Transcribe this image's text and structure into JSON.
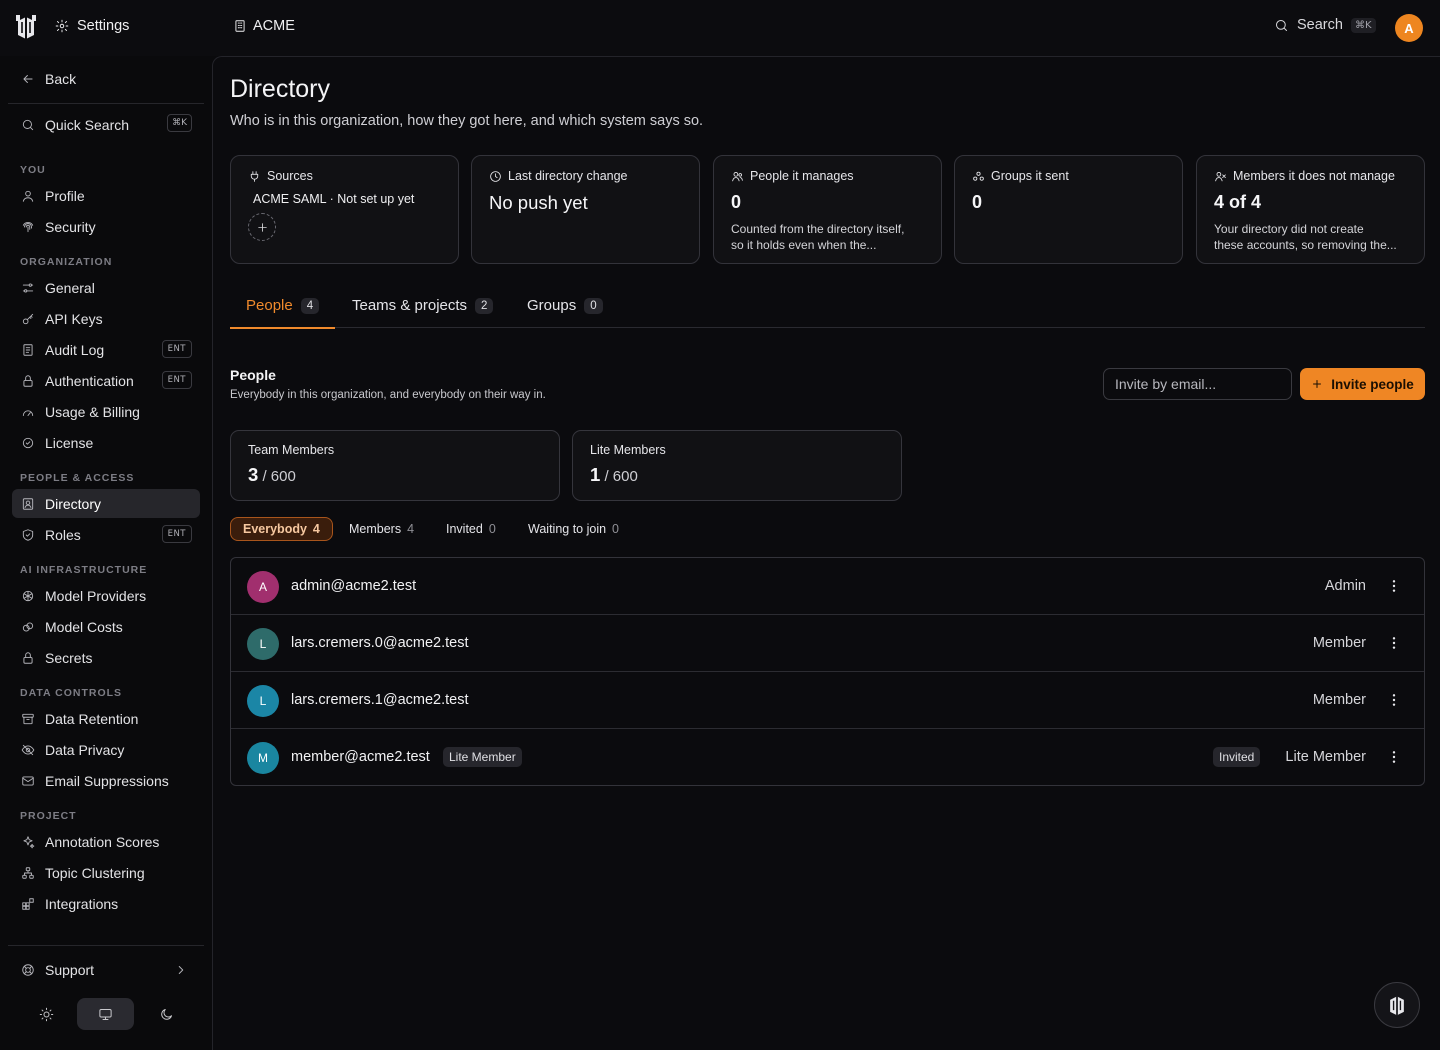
{
  "topbar": {
    "settings_label": "Settings",
    "org_label": "ACME",
    "search_label": "Search",
    "search_shortcut": "⌘K",
    "avatar_initial": "A",
    "avatar_color": "#ee8620"
  },
  "sidebar": {
    "back_label": "Back",
    "quick_search_label": "Quick Search",
    "quick_search_shortcut": "⌘K",
    "sections": {
      "you": "YOU",
      "organization": "ORGANIZATION",
      "people_access": "PEOPLE & ACCESS",
      "ai_infrastructure": "AI INFRASTRUCTURE",
      "data_controls": "DATA CONTROLS",
      "project": "PROJECT"
    },
    "items": {
      "profile": "Profile",
      "security": "Security",
      "general": "General",
      "api_keys": "API Keys",
      "audit_log": "Audit Log",
      "authentication": "Authentication",
      "usage_billing": "Usage & Billing",
      "license": "License",
      "directory": "Directory",
      "roles": "Roles",
      "model_providers": "Model Providers",
      "model_costs": "Model Costs",
      "secrets": "Secrets",
      "data_retention": "Data Retention",
      "data_privacy": "Data Privacy",
      "email_suppressions": "Email Suppressions",
      "annotation_scores": "Annotation Scores",
      "topic_clustering": "Topic Clustering",
      "integrations": "Integrations"
    },
    "ent_badge": "ENT",
    "support_label": "Support",
    "active_item": "Directory",
    "active_theme": "system"
  },
  "page": {
    "title": "Directory",
    "subtitle": "Who is in this organization, how they got here, and which system says so."
  },
  "cards": {
    "sources": {
      "title": "Sources",
      "value": "ACME SAML · Not set up yet"
    },
    "last_change": {
      "title": "Last directory change",
      "value": "No push yet"
    },
    "people_manages": {
      "title": "People it manages",
      "value": "0",
      "note_line1": "Counted from the directory itself,",
      "note_line2": "so it holds even when the..."
    },
    "groups_sent": {
      "title": "Groups it sent",
      "value": "0"
    },
    "not_manage": {
      "title": "Members it does not manage",
      "value": "4 of 4",
      "note_line1": "Your directory did not create",
      "note_line2": "these accounts, so removing the..."
    }
  },
  "tabs": [
    {
      "label": "People",
      "count": "4"
    },
    {
      "label": "Teams & projects",
      "count": "2"
    },
    {
      "label": "Groups",
      "count": "0"
    }
  ],
  "people_section": {
    "title": "People",
    "subtitle": "Everybody in this organization, and everybody on their way in.",
    "invite_placeholder": "Invite by email...",
    "invite_button": "Invite people"
  },
  "seats": {
    "team": {
      "label": "Team Members",
      "used": "3",
      "total": "/ 600"
    },
    "lite": {
      "label": "Lite Members",
      "used": "1",
      "total": "/ 600"
    }
  },
  "filters": [
    {
      "label": "Everybody",
      "count": "4"
    },
    {
      "label": "Members",
      "count": "4"
    },
    {
      "label": "Invited",
      "count": "0"
    },
    {
      "label": "Waiting to join",
      "count": "0"
    }
  ],
  "members": [
    {
      "initial": "A",
      "email": "admin@acme2.test",
      "badge": "",
      "status": "",
      "role": "Admin",
      "color": "#a12f6e"
    },
    {
      "initial": "L",
      "email": "lars.cremers.0@acme2.test",
      "badge": "",
      "status": "",
      "role": "Member",
      "color": "#2e6b6a"
    },
    {
      "initial": "L",
      "email": "lars.cremers.1@acme2.test",
      "badge": "",
      "status": "",
      "role": "Member",
      "color": "#1b86a6"
    },
    {
      "initial": "M",
      "email": "member@acme2.test",
      "badge": "Lite Member",
      "status": "Invited",
      "role": "Lite Member",
      "color": "#1a86a0"
    }
  ],
  "colors": {
    "accent": "#ef8624",
    "background": "#0a0a0c"
  }
}
